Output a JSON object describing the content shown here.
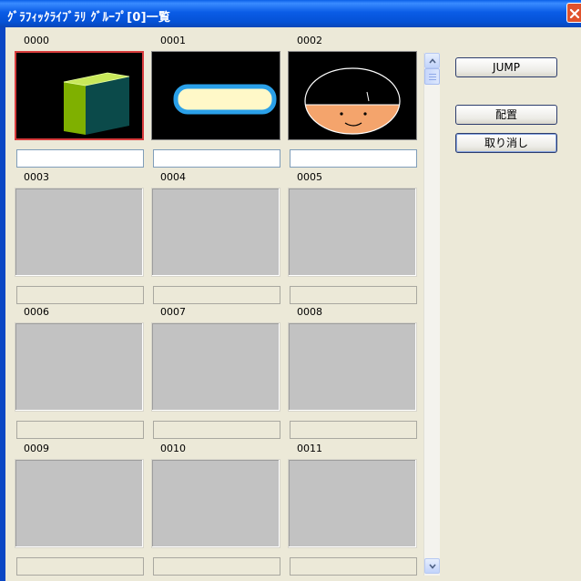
{
  "window": {
    "title": "ｸﾞﾗﾌｨｯｸﾗｲﾌﾞﾗﾘ ｸﾞﾙｰﾌﾟ[0]一覧"
  },
  "cells": [
    {
      "label": "0000"
    },
    {
      "label": "0001"
    },
    {
      "label": "0002"
    },
    {
      "label": "0003"
    },
    {
      "label": "0004"
    },
    {
      "label": "0005"
    },
    {
      "label": "0006"
    },
    {
      "label": "0007"
    },
    {
      "label": "0008"
    },
    {
      "label": "0009"
    },
    {
      "label": "0010"
    },
    {
      "label": "0011"
    }
  ],
  "buttons": {
    "jump": "JUMP",
    "place": "配置",
    "cancel": "取り消し"
  },
  "colors": {
    "title_bar": "#0a5ce6",
    "selected_border": "#d83c3c",
    "cube_face": "#7fb000",
    "cube_side": "#0b4a4a",
    "bar_fill": "#fff8c8",
    "bar_border": "#2aa0e8",
    "face_skin": "#f4a46c"
  },
  "icons": {
    "close": "close-icon",
    "scroll_up": "scroll-up-icon",
    "scroll_down": "scroll-down-icon"
  }
}
